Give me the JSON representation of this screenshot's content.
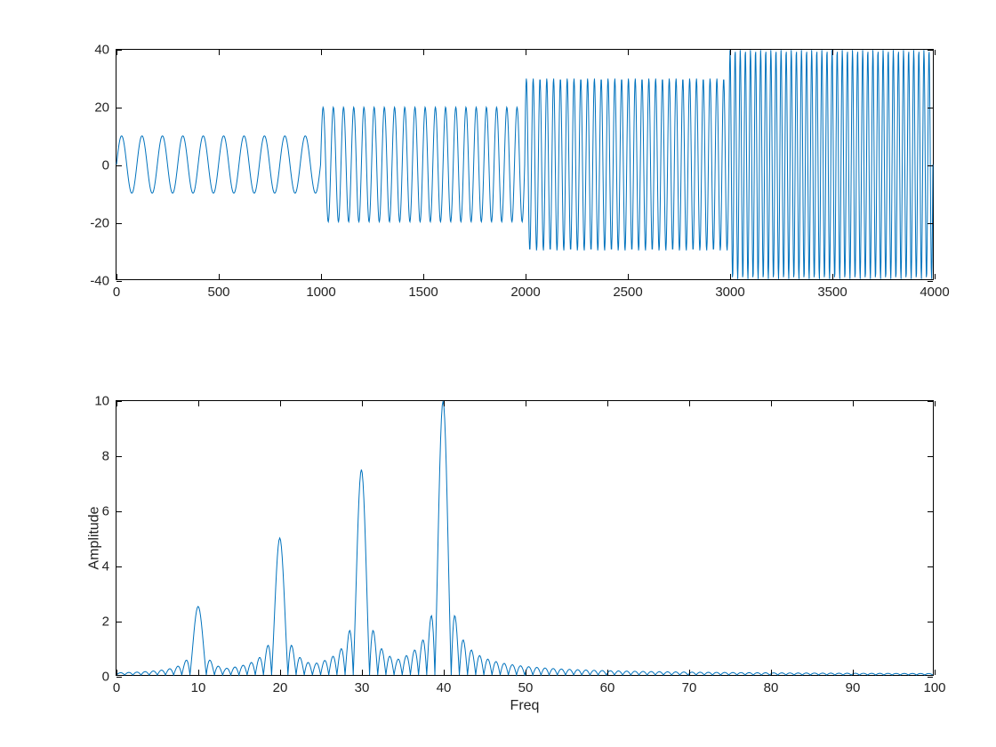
{
  "chart_data": [
    {
      "type": "line",
      "xlabel": "",
      "ylabel": "",
      "xlim": [
        0,
        4000
      ],
      "ylim": [
        -40,
        40
      ],
      "xticks": [
        0,
        500,
        1000,
        1500,
        2000,
        2500,
        3000,
        3500,
        4000
      ],
      "yticks": [
        -40,
        -20,
        0,
        20,
        40
      ],
      "line_color": "#0072bd",
      "signal": {
        "sample_rate": 1000,
        "segments": [
          {
            "start": 0,
            "end": 1000,
            "amplitude": 10,
            "frequency": 10.0
          },
          {
            "start": 1000,
            "end": 2000,
            "amplitude": 20,
            "frequency": 20.0
          },
          {
            "start": 2000,
            "end": 3000,
            "amplitude": 30,
            "frequency": 30.0
          },
          {
            "start": 3000,
            "end": 4000,
            "amplitude": 40,
            "frequency": 40.0
          }
        ]
      }
    },
    {
      "type": "line",
      "xlabel": "Freq",
      "ylabel": "Amplitude",
      "xlim": [
        0,
        100
      ],
      "ylim": [
        0,
        10
      ],
      "xticks": [
        0,
        10,
        20,
        30,
        40,
        50,
        60,
        70,
        80,
        90,
        100
      ],
      "yticks": [
        0,
        2,
        4,
        6,
        8,
        10
      ],
      "line_color": "#0072bd",
      "spectrum": {
        "peaks": [
          {
            "freq": 10,
            "amplitude": 2.5
          },
          {
            "freq": 20,
            "amplitude": 5.0
          },
          {
            "freq": 30,
            "amplitude": 7.5
          },
          {
            "freq": 40,
            "amplitude": 10.0
          }
        ],
        "sidelobe_level": 0.3,
        "window_length_seconds": 1.0
      }
    }
  ],
  "axes1": {
    "xlabel": "",
    "ylabel": ""
  },
  "axes2": {
    "xlabel": "Freq",
    "ylabel": "Amplitude"
  }
}
